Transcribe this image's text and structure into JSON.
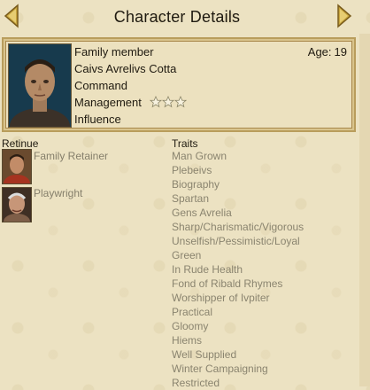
{
  "window": {
    "title": "Character Details",
    "prev_icon": "arrow-left-icon",
    "next_icon": "arrow-right-icon"
  },
  "character": {
    "type": "Family member",
    "name": "Caivs Avrelivs Cotta",
    "age_label": "Age:",
    "age_value": "19",
    "attributes": [
      "Command",
      "Management",
      "Influence"
    ],
    "management_stars": 3
  },
  "retinue": {
    "label": "Retinue",
    "members": [
      "Family Retainer",
      "Playwright"
    ]
  },
  "traits": {
    "label": "Traits",
    "items": [
      "Man Grown",
      "Plebeivs",
      "Biography",
      "Spartan",
      "Gens Avrelia",
      "Sharp/Charismatic/Vigorous",
      "Unselfish/Pessimistic/Loyal",
      "Green",
      "In Rude Health",
      "Fond of Ribald Rhymes",
      "Worshipper of Ivpiter",
      "Practical",
      "Gloomy",
      "Hiems",
      "Well Supplied",
      "Winter Campaigning",
      "Restricted"
    ]
  },
  "colors": {
    "background": "#ece2c2",
    "frame_border": "#b99d5c",
    "arrow": "#c4a239",
    "trait_text": "#8a846f"
  }
}
